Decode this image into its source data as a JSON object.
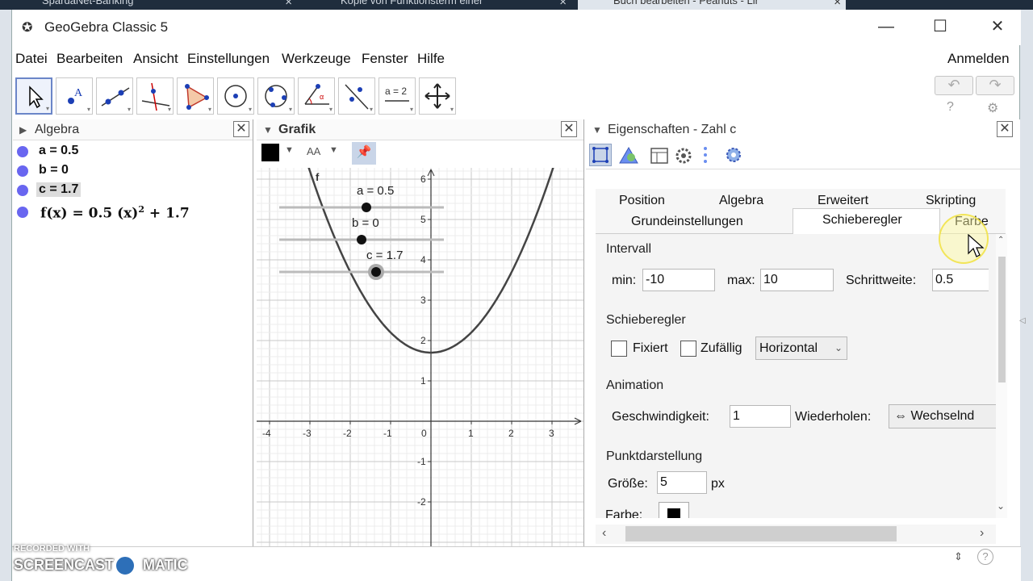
{
  "browser_tabs": [
    {
      "label": "SpardaNet-Banking",
      "active": false
    },
    {
      "label": "Kopie von Funktionsterm einer",
      "active": false
    },
    {
      "label": "Buch bearbeiten - Peanuts - Lir",
      "active": true
    }
  ],
  "app": {
    "title": "GeoGebra Classic 5",
    "logo_icon": "geogebra-logo-icon"
  },
  "menu": {
    "items": [
      "Datei",
      "Bearbeiten",
      "Ansicht",
      "Einstellungen",
      "Werkzeuge",
      "Fenster",
      "Hilfe"
    ],
    "login": "Anmelden"
  },
  "toolbar": {
    "tools": [
      "move-tool-icon",
      "point-tool-icon",
      "line-tool-icon",
      "perpendicular-tool-icon",
      "polygon-tool-icon",
      "circle-tool-icon",
      "conic-tool-icon",
      "angle-tool-icon",
      "reflect-tool-icon",
      "slider-tool-icon",
      "move-view-tool-icon"
    ],
    "slider_tool_label": "a = 2"
  },
  "algebra": {
    "title": "Algebra",
    "items": [
      {
        "expr": "a = 0.5"
      },
      {
        "expr": "b = 0"
      },
      {
        "expr": "c = 1.7",
        "selected": true
      }
    ],
    "func_prefix": "f(x)  =  0.5 (x)",
    "func_exp": "2",
    "func_suffix": " + 1.7"
  },
  "graph": {
    "title": "Grafik",
    "font_btn": "AA",
    "func_label": "f",
    "sliders": [
      {
        "label": "a = 0.5",
        "value": 0.5
      },
      {
        "label": "b = 0",
        "value": 0
      },
      {
        "label": "c = 1.7",
        "value": 1.7
      }
    ],
    "x_ticks": [
      "-4",
      "-3",
      "-2",
      "-1",
      "0",
      "1",
      "2",
      "3"
    ],
    "y_ticks": [
      "6",
      "5",
      "4",
      "3",
      "2",
      "1",
      "-1",
      "-2"
    ]
  },
  "chart_data": {
    "type": "line",
    "function": "f(x) = 0.5 (x)^2 + 1.7",
    "a": 0.5,
    "b": 0,
    "c": 1.7,
    "xlim": [
      -4.3,
      3.7
    ],
    "ylim": [
      -3,
      6.3
    ],
    "grid": true
  },
  "props": {
    "title": "Eigenschaften - Zahl c",
    "tabs_row1": [
      "Position",
      "Algebra",
      "Erweitert",
      "Skripting"
    ],
    "tabs_row2": [
      "Grundeinstellungen",
      "Schieberegler",
      "Farbe"
    ],
    "active_tab": "Schieberegler",
    "intervall": {
      "title": "Intervall",
      "min_label": "min:",
      "min": "-10",
      "max_label": "max:",
      "max": "10",
      "step_label": "Schrittweite:",
      "step": "0.5"
    },
    "slider": {
      "title": "Schieberegler",
      "fixed": "Fixiert",
      "random": "Zufällig",
      "orientation": "Horizontal"
    },
    "animation": {
      "title": "Animation",
      "speed_label": "Geschwindigkeit:",
      "speed": "1",
      "repeat_label": "Wiederholen:",
      "repeat": "⇔ Wechselnd"
    },
    "point": {
      "title": "Punktdarstellung",
      "size_label": "Größe:",
      "size": "5",
      "unit": "px",
      "color_label": "Farbe:",
      "color": "#000000"
    }
  },
  "statusbar": {
    "watermark_top": "RECORDED WITH",
    "watermark_brand": "SCREENCAST",
    "watermark_brand2": "MATIC"
  }
}
